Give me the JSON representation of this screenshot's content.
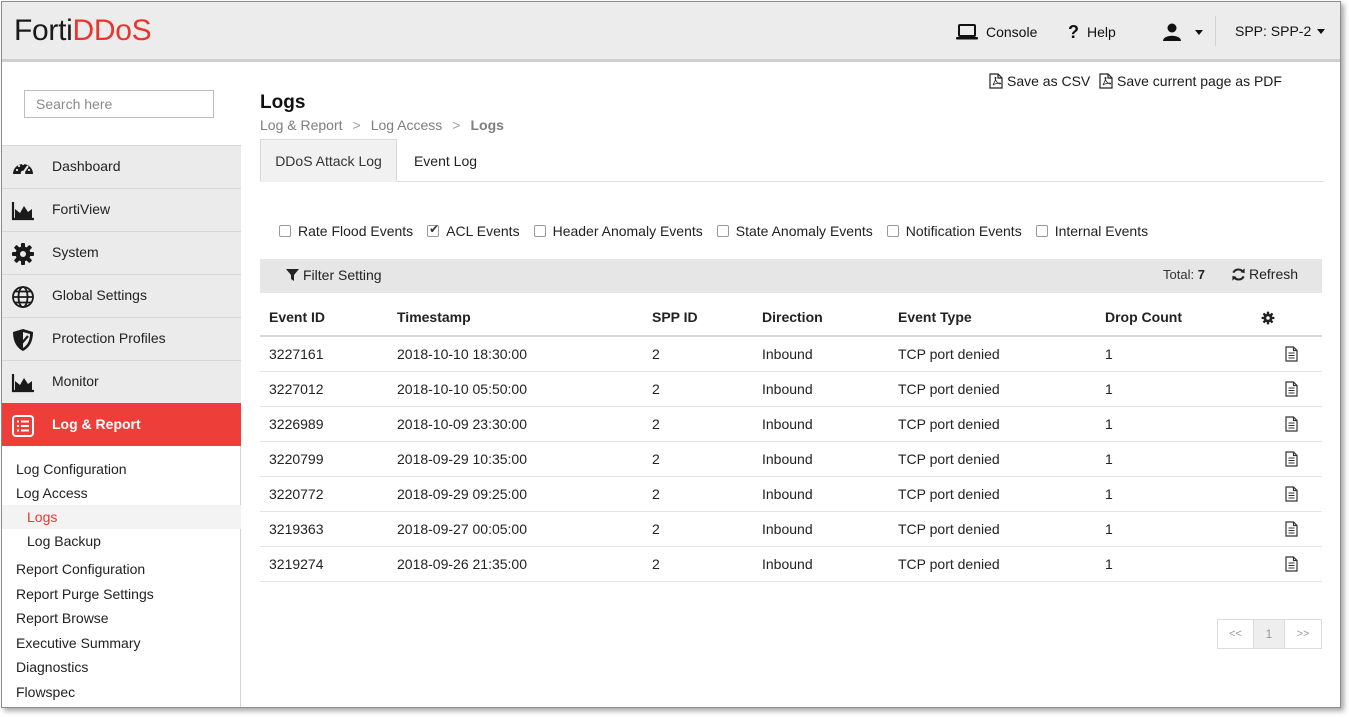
{
  "header": {
    "logo_prefix": "Forti",
    "logo_suffix": "DDoS",
    "console_label": "Console",
    "help_label": "Help",
    "spp_label": "SPP: SPP-2",
    "brand_color": "#e7372d"
  },
  "sidebar": {
    "search_placeholder": "Search here",
    "items": [
      {
        "label": "Dashboard",
        "icon": "dashboard-gauge-icon"
      },
      {
        "label": "FortiView",
        "icon": "area-chart-icon"
      },
      {
        "label": "System",
        "icon": "gear-icon"
      },
      {
        "label": "Global Settings",
        "icon": "globe-icon"
      },
      {
        "label": "Protection Profiles",
        "icon": "shield-icon"
      },
      {
        "label": "Monitor",
        "icon": "area-chart-icon"
      },
      {
        "label": "Log & Report",
        "icon": "list-report-icon"
      }
    ],
    "active_color": "#ee3e3a",
    "sub_items": [
      {
        "label": "Log Configuration"
      },
      {
        "label": "Log Access"
      },
      {
        "label": "Logs"
      },
      {
        "label": "Log Backup"
      },
      {
        "label": "Report Configuration"
      },
      {
        "label": "Report Purge Settings"
      },
      {
        "label": "Report Browse"
      },
      {
        "label": "Executive Summary"
      },
      {
        "label": "Diagnostics"
      },
      {
        "label": "Flowspec"
      }
    ]
  },
  "main": {
    "save_csv": "Save as CSV",
    "save_pdf": "Save current page as PDF",
    "title": "Logs",
    "breadcrumb": [
      "Log & Report",
      "Log Access",
      "Logs"
    ],
    "breadcrumb_sep": ">",
    "tabs": [
      "DDoS Attack Log",
      "Event Log"
    ],
    "filters": [
      {
        "label": "Rate Flood Events",
        "checked": false
      },
      {
        "label": "ACL Events",
        "checked": true
      },
      {
        "label": "Header Anomaly Events",
        "checked": false
      },
      {
        "label": "State Anomaly Events",
        "checked": false
      },
      {
        "label": "Notification Events",
        "checked": false
      },
      {
        "label": "Internal Events",
        "checked": false
      }
    ],
    "filter_setting": "Filter Setting",
    "total_label": "Total:",
    "total_value": "7",
    "refresh_label": "Refresh",
    "columns": [
      "Event ID",
      "Timestamp",
      "SPP ID",
      "Direction",
      "Event Type",
      "Drop Count"
    ],
    "rows": [
      [
        "3227161",
        "2018-10-10 18:30:00",
        "2",
        "Inbound",
        "TCP port denied",
        "1"
      ],
      [
        "3227012",
        "2018-10-10 05:50:00",
        "2",
        "Inbound",
        "TCP port denied",
        "1"
      ],
      [
        "3226989",
        "2018-10-09 23:30:00",
        "2",
        "Inbound",
        "TCP port denied",
        "1"
      ],
      [
        "3220799",
        "2018-09-29 10:35:00",
        "2",
        "Inbound",
        "TCP port denied",
        "1"
      ],
      [
        "3220772",
        "2018-09-29 09:25:00",
        "2",
        "Inbound",
        "TCP port denied",
        "1"
      ],
      [
        "3219363",
        "2018-09-27 00:05:00",
        "2",
        "Inbound",
        "TCP port denied",
        "1"
      ],
      [
        "3219274",
        "2018-09-26 21:35:00",
        "2",
        "Inbound",
        "TCP port denied",
        "1"
      ]
    ],
    "pager": {
      "prev": "<<",
      "page": "1",
      "next": ">>"
    }
  }
}
